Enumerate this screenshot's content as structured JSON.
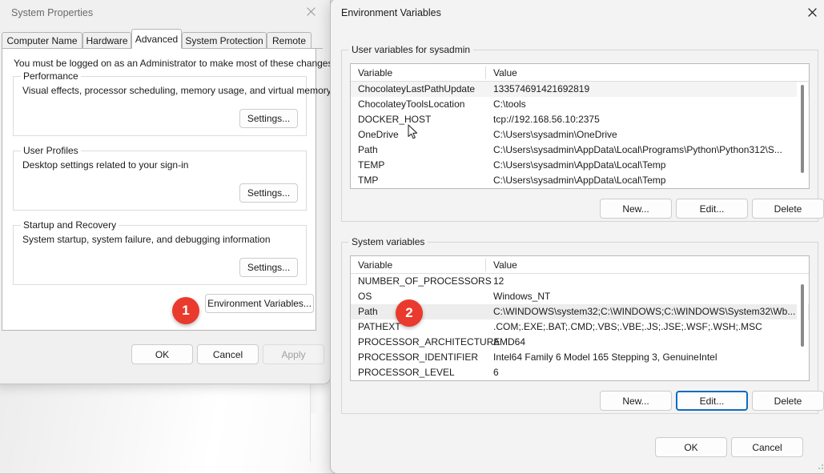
{
  "system_properties": {
    "title": "System Properties",
    "close_icon": "close-icon",
    "tabs": [
      {
        "label": "Computer Name",
        "active": false
      },
      {
        "label": "Hardware",
        "active": false
      },
      {
        "label": "Advanced",
        "active": true
      },
      {
        "label": "System Protection",
        "active": false
      },
      {
        "label": "Remote",
        "active": false
      }
    ],
    "note": "You must be logged on as an Administrator to make most of these changes.",
    "groups": [
      {
        "label": "Performance",
        "description": "Visual effects, processor scheduling, memory usage, and virtual memory",
        "button": "Settings..."
      },
      {
        "label": "User Profiles",
        "description": "Desktop settings related to your sign-in",
        "button": "Settings..."
      },
      {
        "label": "Startup and Recovery",
        "description": "System startup, system failure, and debugging information",
        "button": "Settings..."
      }
    ],
    "environment_variables_button": "Environment Variables...",
    "footer": {
      "ok": "OK",
      "cancel": "Cancel",
      "apply": "Apply"
    }
  },
  "environment_variables": {
    "title": "Environment Variables",
    "close_icon": "close-icon",
    "user_section": {
      "label": "User variables for sysadmin",
      "columns": [
        "Variable",
        "Value"
      ],
      "rows": [
        {
          "name": "ChocolateyLastPathUpdate",
          "value": "133574691421692819"
        },
        {
          "name": "ChocolateyToolsLocation",
          "value": "C:\\tools"
        },
        {
          "name": "DOCKER_HOST",
          "value": "tcp://192.168.56.10:2375"
        },
        {
          "name": "OneDrive",
          "value": "C:\\Users\\sysadmin\\OneDrive"
        },
        {
          "name": "Path",
          "value": "C:\\Users\\sysadmin\\AppData\\Local\\Programs\\Python\\Python312\\S..."
        },
        {
          "name": "TEMP",
          "value": "C:\\Users\\sysadmin\\AppData\\Local\\Temp"
        },
        {
          "name": "TMP",
          "value": "C:\\Users\\sysadmin\\AppData\\Local\\Temp"
        }
      ],
      "buttons": {
        "new": "New...",
        "edit": "Edit...",
        "delete": "Delete"
      }
    },
    "system_section": {
      "label": "System variables",
      "columns": [
        "Variable",
        "Value"
      ],
      "rows": [
        {
          "name": "NUMBER_OF_PROCESSORS",
          "value": "12"
        },
        {
          "name": "OS",
          "value": "Windows_NT"
        },
        {
          "name": "Path",
          "value": "C:\\WINDOWS\\system32;C:\\WINDOWS;C:\\WINDOWS\\System32\\Wb..."
        },
        {
          "name": "PATHEXT",
          "value": ".COM;.EXE;.BAT;.CMD;.VBS;.VBE;.JS;.JSE;.WSF;.WSH;.MSC"
        },
        {
          "name": "PROCESSOR_ARCHITECTURE",
          "value": "AMD64"
        },
        {
          "name": "PROCESSOR_IDENTIFIER",
          "value": "Intel64 Family 6 Model 165 Stepping 3, GenuineIntel"
        },
        {
          "name": "PROCESSOR_LEVEL",
          "value": "6"
        }
      ],
      "buttons": {
        "new": "New...",
        "edit": "Edit...",
        "delete": "Delete"
      }
    },
    "footer": {
      "ok": "OK",
      "cancel": "Cancel"
    }
  },
  "annotations": [
    {
      "number": "1",
      "target": "environment-variables-button"
    },
    {
      "number": "2",
      "target": "system-variable-path-row"
    }
  ],
  "colors": {
    "badge": "#ea3a2d",
    "focus_border": "#0f6cbd",
    "window_bg": "#f3f3f3",
    "selection": "#ededed"
  }
}
